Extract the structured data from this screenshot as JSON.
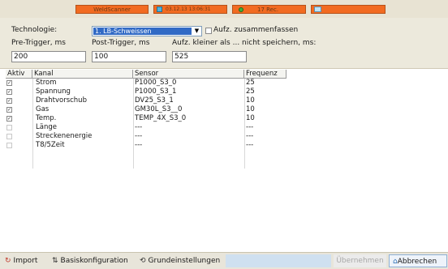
{
  "status": {
    "app_name": "WeldScanner",
    "datetime": "03.12.13 13:06:31",
    "records": "17 Rec.",
    "progress_fraction": 0.0
  },
  "settings": {
    "technology_label": "Technologie:",
    "technology_value": "1. LB-Schweissen",
    "merge_label": "Aufz. zusammenfassen",
    "merge_checked": false,
    "pretrigger_label": "Pre-Trigger, ms",
    "pretrigger_value": "200",
    "posttrigger_label": "Post-Trigger, ms",
    "posttrigger_value": "100",
    "minlen_label": "Aufz. kleiner als ... nicht speichern, ms:",
    "minlen_value": "525"
  },
  "table": {
    "headers": [
      "Aktiv",
      "Kanal",
      "Sensor",
      "Frequenz"
    ],
    "rows": [
      {
        "active": true,
        "kanal": "Strom",
        "sensor": "P1000_S3_0",
        "freq": "25"
      },
      {
        "active": true,
        "kanal": "Spannung",
        "sensor": "P1000_S3_1",
        "freq": "25"
      },
      {
        "active": true,
        "kanal": "Drahtvorschub",
        "sensor": "DV25_S3_1",
        "freq": "10"
      },
      {
        "active": true,
        "kanal": "Gas",
        "sensor": "GM30L_S3__0",
        "freq": "10"
      },
      {
        "active": true,
        "kanal": "Temp.",
        "sensor": "TEMP_4X_S3_0",
        "freq": "10"
      },
      {
        "active": false,
        "kanal": "Länge",
        "sensor": "---",
        "freq": "---"
      },
      {
        "active": false,
        "kanal": "Streckenenergie",
        "sensor": "---",
        "freq": "---"
      },
      {
        "active": false,
        "kanal": "T8/5Zeit",
        "sensor": "---",
        "freq": "---"
      }
    ]
  },
  "toolbar": {
    "import_label": "Import",
    "basis_label": "Basiskonfiguration",
    "grund_label": "Grundeinstellungen",
    "apply_label": "Übernehmen",
    "cancel_label": "Abbrechen"
  }
}
